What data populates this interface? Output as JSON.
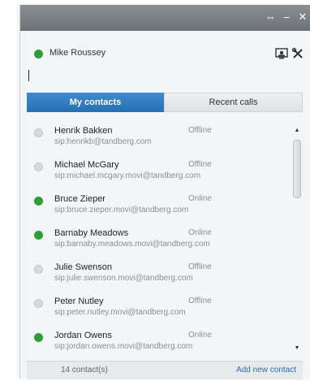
{
  "window": {
    "controls": [
      {
        "name": "pin-icon",
        "glyph": "⇔"
      },
      {
        "name": "minimize-icon",
        "glyph": "–"
      },
      {
        "name": "close-icon",
        "glyph": "✕"
      }
    ]
  },
  "user": {
    "name": "Mike Roussey",
    "presence_color": "#2e9e3a"
  },
  "search": {
    "value": ""
  },
  "tabs": [
    {
      "label": "My contacts",
      "active": true
    },
    {
      "label": "Recent calls",
      "active": false
    }
  ],
  "colors": {
    "online": "#2e9e3a",
    "offline": "#d7d9db",
    "accent": "#2a6fb0"
  },
  "contacts": [
    {
      "name": "Henrik Bakken",
      "sip": "sip:henrikb@tandberg.com",
      "status": "Offline"
    },
    {
      "name": "Michael McGary",
      "sip": "sip:michael.mcgary.movi@tandberg.com",
      "status": "Offline"
    },
    {
      "name": "Bruce Zieper",
      "sip": "sip:bruce.zieper.movi@tandberg.com",
      "status": "Online"
    },
    {
      "name": "Barnaby Meadows",
      "sip": "sip:barnaby.meadows.movi@tandberg.com",
      "status": "Online"
    },
    {
      "name": "Julie Swenson",
      "sip": "sip:julie.swenson.movi@tandberg.com",
      "status": "Offline"
    },
    {
      "name": "Peter Nutley",
      "sip": "sip:peter.nutley.movi@tandberg.com",
      "status": "Offline"
    },
    {
      "name": "Jordan Owens",
      "sip": "sip:jordan.owens.movi@tandberg.com",
      "status": "Online"
    }
  ],
  "footer": {
    "count_label": "14 contact(s)",
    "add_label": "Add new contact"
  }
}
